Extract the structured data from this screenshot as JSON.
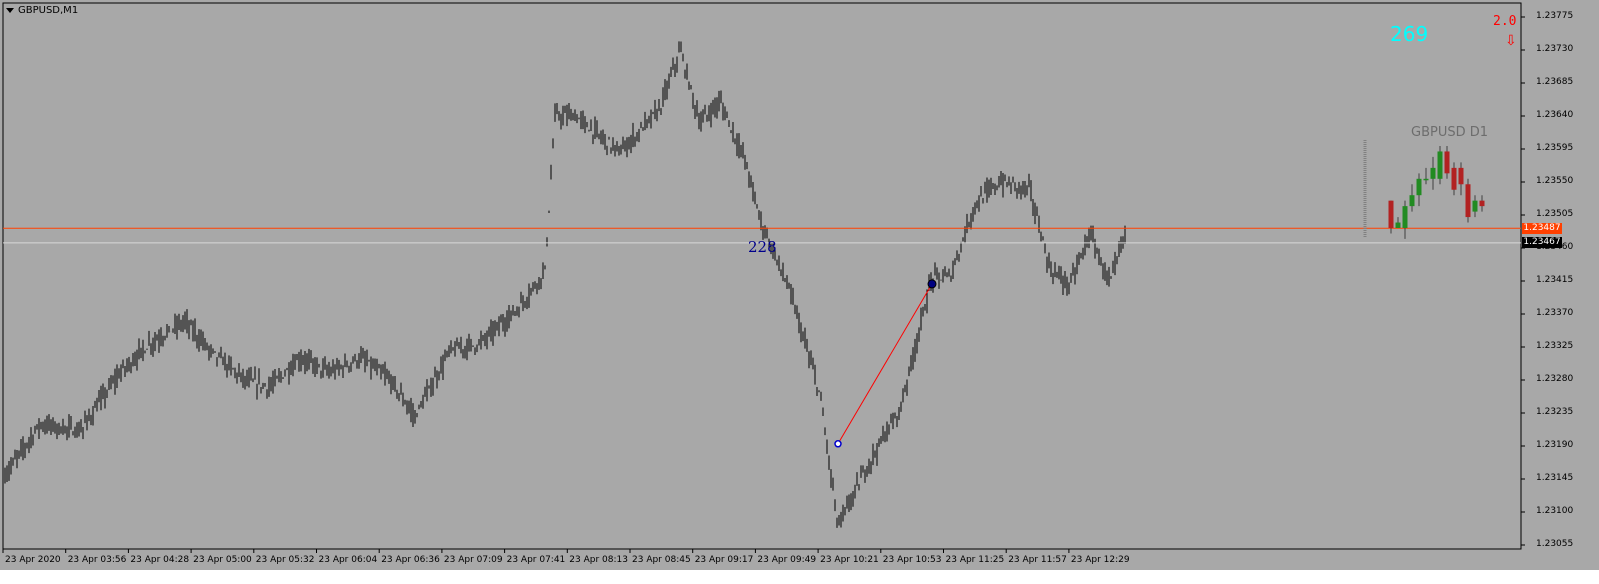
{
  "window": {
    "symbol_label": "GBPUSD,M1"
  },
  "colors": {
    "background": "#a8a8a8",
    "bars": "#000000",
    "ask_line": "#ff4000",
    "bid_line": "#d8d8d8",
    "trend_line": "#ff0000",
    "bull_candle": "#228b22",
    "bear_candle": "#b22222"
  },
  "price_tags": {
    "ask": "1.23487",
    "bid": "1.23467"
  },
  "indicators": {
    "spread": "269",
    "ratio": "2.0",
    "arrow": "⇩",
    "bars_count": "228"
  },
  "mini_chart": {
    "title": "GBPUSD D1"
  },
  "chart_data": {
    "type": "bar",
    "title": "GBPUSD,M1",
    "y_ticks": [
      "1.23775",
      "1.23730",
      "1.23685",
      "1.23640",
      "1.23595",
      "1.23550",
      "1.23505",
      "1.23460",
      "1.23415",
      "1.23370",
      "1.23325",
      "1.23280",
      "1.23235",
      "1.23190",
      "1.23145",
      "1.23100",
      "1.23055"
    ],
    "x_ticks": [
      "23 Apr 2020",
      "23 Apr 03:56",
      "23 Apr 04:28",
      "23 Apr 05:00",
      "23 Apr 05:32",
      "23 Apr 06:04",
      "23 Apr 06:36",
      "23 Apr 07:09",
      "23 Apr 07:41",
      "23 Apr 08:13",
      "23 Apr 08:45",
      "23 Apr 09:17",
      "23 Apr 09:49",
      "23 Apr 10:21",
      "23 Apr 10:53",
      "23 Apr 11:25",
      "23 Apr 11:57",
      "23 Apr 12:29"
    ],
    "ylim": [
      1.23055,
      1.238
    ],
    "close_path": [
      [
        0,
        1.2314
      ],
      [
        40,
        1.2322
      ],
      [
        80,
        1.2321
      ],
      [
        120,
        1.2329
      ],
      [
        150,
        1.2333
      ],
      [
        185,
        1.2336
      ],
      [
        210,
        1.2332
      ],
      [
        245,
        1.2328
      ],
      [
        270,
        1.2327
      ],
      [
        300,
        1.2331
      ],
      [
        330,
        1.2329
      ],
      [
        360,
        1.2331
      ],
      [
        390,
        1.2328
      ],
      [
        415,
        1.2323
      ],
      [
        450,
        1.2332
      ],
      [
        480,
        1.2333
      ],
      [
        520,
        1.2338
      ],
      [
        545,
        1.2343
      ],
      [
        555,
        1.2364
      ],
      [
        575,
        1.2364
      ],
      [
        620,
        1.2359
      ],
      [
        660,
        1.2365
      ],
      [
        680,
        1.2373
      ],
      [
        700,
        1.2363
      ],
      [
        720,
        1.2366
      ],
      [
        745,
        1.2358
      ],
      [
        760,
        1.235
      ],
      [
        790,
        1.234
      ],
      [
        820,
        1.2326
      ],
      [
        838,
        1.2308
      ],
      [
        870,
        1.2317
      ],
      [
        900,
        1.2324
      ],
      [
        932,
        1.2342
      ],
      [
        950,
        1.2342
      ],
      [
        975,
        1.2352
      ],
      [
        1000,
        1.2355
      ],
      [
        1030,
        1.2354
      ],
      [
        1050,
        1.2343
      ],
      [
        1070,
        1.2341
      ],
      [
        1090,
        1.2348
      ],
      [
        1110,
        1.2341
      ],
      [
        1125,
        1.2348
      ]
    ],
    "ask": 1.23487,
    "bid": 1.23467,
    "trend_line": {
      "from": [
        838,
        1.23193
      ],
      "to": [
        932,
        1.23411
      ]
    },
    "d1_candles": [
      {
        "o": 1.2351,
        "c": 1.2346,
        "h": 1.2351,
        "l": 1.2345
      },
      {
        "o": 1.2346,
        "c": 1.2347,
        "h": 1.2348,
        "l": 1.2346
      },
      {
        "o": 1.2346,
        "c": 1.235,
        "h": 1.2351,
        "l": 1.2344
      },
      {
        "o": 1.235,
        "c": 1.2352,
        "h": 1.2354,
        "l": 1.2349
      },
      {
        "o": 1.2352,
        "c": 1.2355,
        "h": 1.2356,
        "l": 1.235
      },
      {
        "o": 1.2355,
        "c": 1.2355,
        "h": 1.2357,
        "l": 1.2354
      },
      {
        "o": 1.2355,
        "c": 1.2357,
        "h": 1.2359,
        "l": 1.2353
      },
      {
        "o": 1.2355,
        "c": 1.236,
        "h": 1.2361,
        "l": 1.2354
      },
      {
        "o": 1.236,
        "c": 1.2356,
        "h": 1.2361,
        "l": 1.2355
      },
      {
        "o": 1.2357,
        "c": 1.2353,
        "h": 1.2358,
        "l": 1.2352
      },
      {
        "o": 1.2357,
        "c": 1.2354,
        "h": 1.2358,
        "l": 1.2352
      },
      {
        "o": 1.2354,
        "c": 1.2348,
        "h": 1.2355,
        "l": 1.2347
      },
      {
        "o": 1.2349,
        "c": 1.2351,
        "h": 1.2352,
        "l": 1.2348
      },
      {
        "o": 1.2351,
        "c": 1.235,
        "h": 1.2352,
        "l": 1.2349
      }
    ]
  }
}
